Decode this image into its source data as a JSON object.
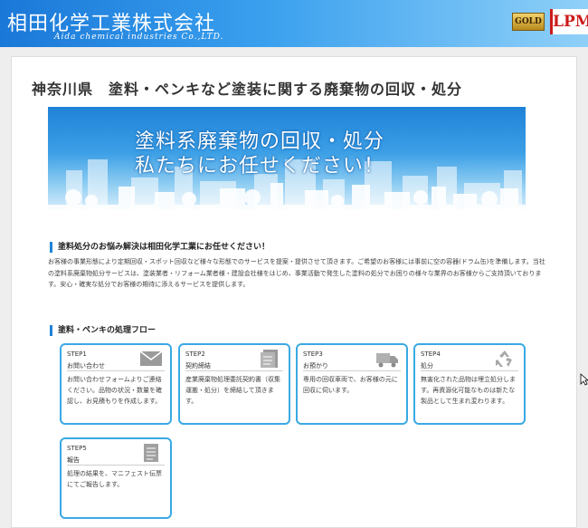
{
  "header": {
    "logo_jp": "相田化学工業株式会社",
    "logo_en": "Aida chemical industries Co.,LTD.",
    "badge_gold": "GOLD",
    "badge_lpm": "LPM"
  },
  "page": {
    "title": "神奈川県　塗料・ペンキなど塗装に関する廃棄物の回収・処分"
  },
  "banner": {
    "line1": "塗料系廃棄物の回収・処分",
    "line2": "私たちにお任せください！"
  },
  "intro": {
    "heading": "塗料処分のお悩み解決は相田化学工業にお任せください！",
    "body": "お客様の事業形態により定期回収・スポット回収など様々な形態でのサービスを提案・提供させて頂きます。ご希望のお客様には事前に空の容器(ドラム缶)を準備します。当社の塗料系廃棄物処分サービスは、塗装業者・リフォーム業者様・建設会社様をはじめ、事業活動で発生した塗料の処分でお困りの様々な業界のお客様からご支持頂いております。安心・確実な処分でお客様の期待に添えるサービスを提供します。"
  },
  "flow": {
    "heading": "塗料・ペンキの処理フロー",
    "steps": [
      {
        "label": "STEP1",
        "title": "お問い合わせ",
        "desc": "お問い合わせフォームよりご連絡ください。品物の状況・数量を確認し、お見積もりを作成します。",
        "icon": "mail-icon"
      },
      {
        "label": "STEP2",
        "title": "契約締結",
        "desc": "産業廃棄物処理委託契約書（収集運搬・処分）を締結して頂きます。",
        "icon": "document-icon"
      },
      {
        "label": "STEP3",
        "title": "お預かり",
        "desc": "専用の回収車両で、お客様の元に回収に伺います。",
        "icon": "truck-icon"
      },
      {
        "label": "STEP4",
        "title": "処分",
        "desc": "無害化された品物は埋立処分します。再資源化可能なものは新たな製品として生まれ変わります。",
        "icon": "recycle-icon"
      },
      {
        "label": "STEP5",
        "title": "報告",
        "desc": "処理の結果を、マニフェスト伝票にてご報告します。",
        "icon": "report-icon"
      }
    ]
  },
  "colors": {
    "accent": "#39a9e4",
    "header_blue": "#1a78d8",
    "lpm_red": "#cc1a1a"
  }
}
